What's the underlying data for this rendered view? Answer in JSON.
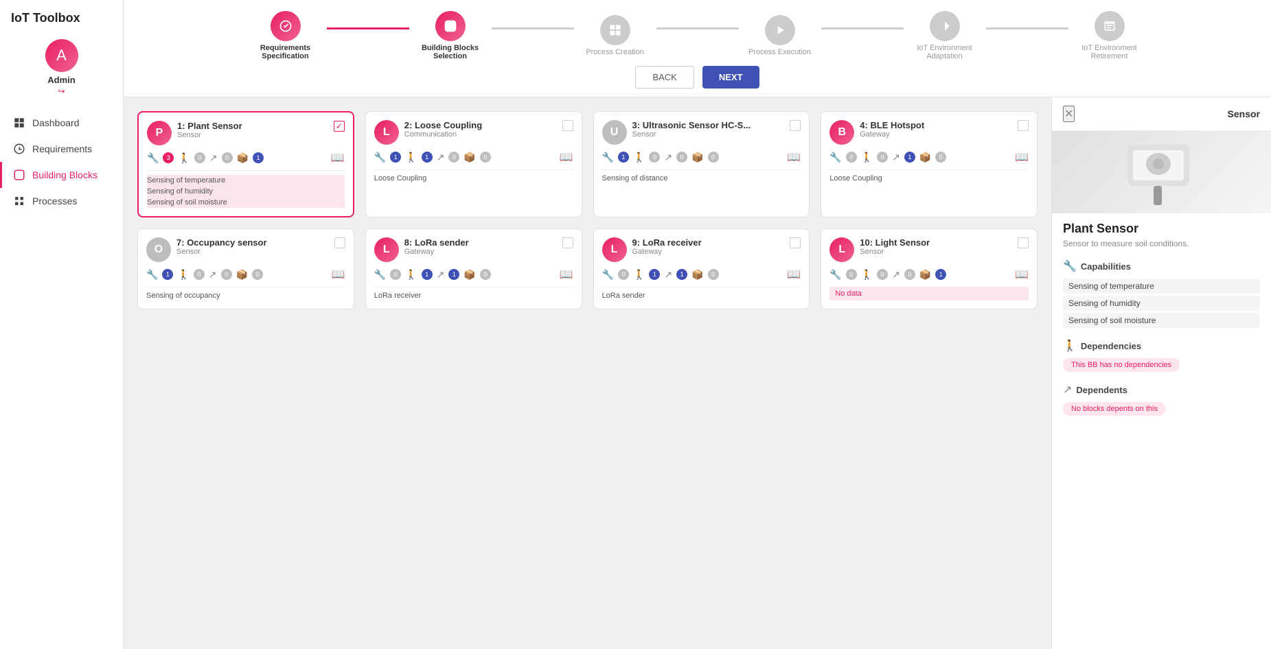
{
  "app": {
    "title": "IoT Toolbox"
  },
  "sidebar": {
    "user": {
      "initial": "A",
      "name": "Admin",
      "logout_icon": "↪"
    },
    "nav_items": [
      {
        "id": "dashboard",
        "label": "Dashboard",
        "active": false
      },
      {
        "id": "requirements",
        "label": "Requirements",
        "active": false
      },
      {
        "id": "building-blocks",
        "label": "Building Blocks",
        "active": true
      },
      {
        "id": "processes",
        "label": "Processes",
        "active": false
      }
    ]
  },
  "wizard": {
    "steps": [
      {
        "id": "requirements",
        "label": "Requirements Specification",
        "state": "completed",
        "icon": "⚙"
      },
      {
        "id": "building-blocks",
        "label": "Building Blocks Selection",
        "state": "active",
        "icon": "⬡"
      },
      {
        "id": "process-creation",
        "label": "Process Creation",
        "state": "inactive",
        "icon": "⧉"
      },
      {
        "id": "process-execution",
        "label": "Process Execution",
        "state": "inactive",
        "icon": "▷"
      },
      {
        "id": "iot-adaptation",
        "label": "IoT Environment Adaptation",
        "state": "inactive",
        "icon": "⇄"
      },
      {
        "id": "iot-retirement",
        "label": "IoT Environment Retirement",
        "state": "inactive",
        "icon": "✉"
      }
    ],
    "back_label": "BACK",
    "next_label": "NEXT"
  },
  "cards": [
    {
      "id": 1,
      "number": "1:",
      "name": "Plant Sensor",
      "type": "Sensor",
      "initial": "P",
      "color": "red",
      "selected": true,
      "metrics": [
        {
          "icon": "🔧",
          "count": 3,
          "color": "red"
        },
        {
          "icon": "🚶",
          "count": 0,
          "color": "gray"
        },
        {
          "icon": "↗",
          "count": 0,
          "color": "gray"
        },
        {
          "icon": "📦",
          "count": 1,
          "color": "blue"
        }
      ],
      "capabilities": [
        "Sensing of temperature",
        "Sensing of humidity",
        "Sensing of soil moisture"
      ],
      "cap_type": "list"
    },
    {
      "id": 2,
      "number": "2:",
      "name": "Loose Coupling",
      "type": "Communication",
      "initial": "L",
      "color": "red",
      "selected": false,
      "metrics": [
        {
          "icon": "🔧",
          "count": 1,
          "color": "blue"
        },
        {
          "icon": "🚶",
          "count": 1,
          "color": "blue"
        },
        {
          "icon": "↗",
          "count": 0,
          "color": "gray"
        },
        {
          "icon": "📦",
          "count": 0,
          "color": "gray"
        }
      ],
      "capabilities": [
        "Loose Coupling"
      ],
      "cap_type": "text"
    },
    {
      "id": 3,
      "number": "3:",
      "name": "Ultrasonic Sensor HC-S...",
      "type": "Sensor",
      "initial": "U",
      "color": "gray",
      "selected": false,
      "metrics": [
        {
          "icon": "🔧",
          "count": 1,
          "color": "blue"
        },
        {
          "icon": "🚶",
          "count": 0,
          "color": "gray"
        },
        {
          "icon": "↗",
          "count": 0,
          "color": "gray"
        },
        {
          "icon": "📦",
          "count": 0,
          "color": "gray"
        }
      ],
      "capabilities": [
        "Sensing of distance"
      ],
      "cap_type": "text"
    },
    {
      "id": 4,
      "number": "4:",
      "name": "BLE Hotspot",
      "type": "Gateway",
      "initial": "B",
      "color": "red",
      "selected": false,
      "metrics": [
        {
          "icon": "🔧",
          "count": 0,
          "color": "gray"
        },
        {
          "icon": "🚶",
          "count": 0,
          "color": "gray"
        },
        {
          "icon": "↗",
          "count": 1,
          "color": "blue"
        },
        {
          "icon": "📦",
          "count": 0,
          "color": "gray"
        }
      ],
      "capabilities": [
        "Loose Coupling"
      ],
      "cap_type": "text"
    },
    {
      "id": 7,
      "number": "7:",
      "name": "Occupancy sensor",
      "type": "Sensor",
      "initial": "O",
      "color": "gray",
      "selected": false,
      "metrics": [
        {
          "icon": "🔧",
          "count": 1,
          "color": "blue"
        },
        {
          "icon": "🚶",
          "count": 0,
          "color": "gray"
        },
        {
          "icon": "↗",
          "count": 0,
          "color": "gray"
        },
        {
          "icon": "📦",
          "count": 0,
          "color": "gray"
        }
      ],
      "capabilities": [
        "Sensing of occupancy"
      ],
      "cap_type": "text"
    },
    {
      "id": 8,
      "number": "8:",
      "name": "LoRa sender",
      "type": "Gateway",
      "initial": "L",
      "color": "red",
      "selected": false,
      "metrics": [
        {
          "icon": "🔧",
          "count": 0,
          "color": "gray"
        },
        {
          "icon": "🚶",
          "count": 1,
          "color": "blue"
        },
        {
          "icon": "↗",
          "count": 1,
          "color": "blue"
        },
        {
          "icon": "📦",
          "count": 0,
          "color": "gray"
        }
      ],
      "capabilities": [
        "LoRa receiver"
      ],
      "cap_type": "text"
    },
    {
      "id": 9,
      "number": "9:",
      "name": "LoRa receiver",
      "type": "Gateway",
      "initial": "L",
      "color": "red",
      "selected": false,
      "metrics": [
        {
          "icon": "🔧",
          "count": 0,
          "color": "gray"
        },
        {
          "icon": "🚶",
          "count": 1,
          "color": "blue"
        },
        {
          "icon": "↗",
          "count": 1,
          "color": "blue"
        },
        {
          "icon": "📦",
          "count": 0,
          "color": "gray"
        }
      ],
      "capabilities": [
        "LoRa sender"
      ],
      "cap_type": "text"
    },
    {
      "id": 10,
      "number": "10:",
      "name": "Light Sensor",
      "type": "Sensor",
      "initial": "L",
      "color": "red",
      "selected": false,
      "metrics": [
        {
          "icon": "🔧",
          "count": 0,
          "color": "gray"
        },
        {
          "icon": "🚶",
          "count": 0,
          "color": "gray"
        },
        {
          "icon": "↗",
          "count": 0,
          "color": "gray"
        },
        {
          "icon": "📦",
          "count": 1,
          "color": "blue"
        }
      ],
      "capabilities": null,
      "cap_type": "nodata"
    }
  ],
  "detail_panel": {
    "title": "Sensor",
    "name": "Plant Sensor",
    "description": "Sensor to measure soil conditions.",
    "capabilities_label": "Capabilities",
    "capabilities": [
      "Sensing of temperature",
      "Sensing of humidity",
      "Sensing of soil moisture"
    ],
    "dependencies_label": "Dependencies",
    "no_dependencies": "This BB has no dependencies",
    "dependents_label": "Dependents",
    "no_dependents": "No blocks depents on this"
  }
}
